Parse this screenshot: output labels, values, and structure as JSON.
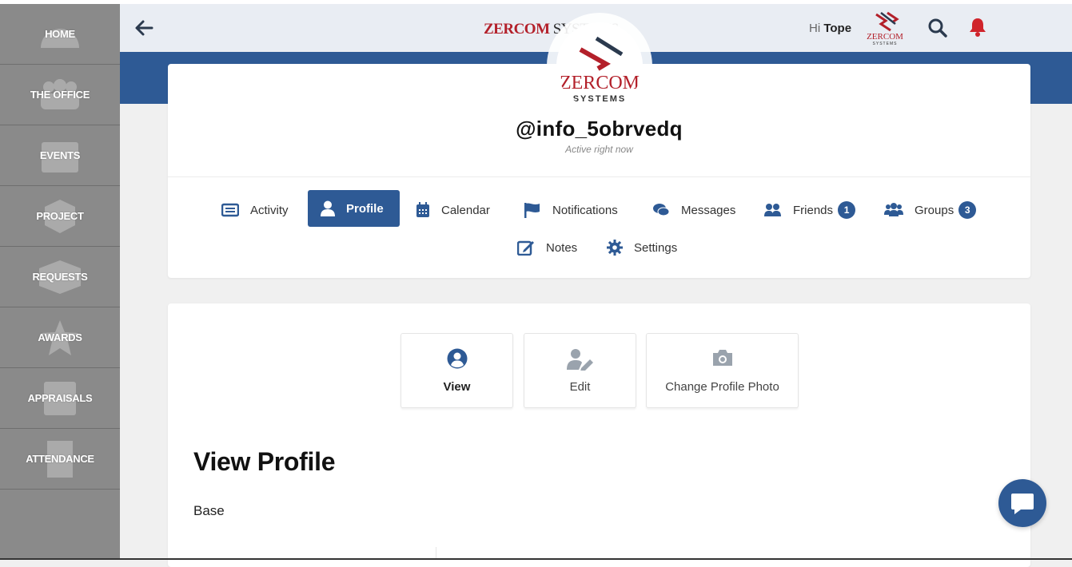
{
  "sidebar": {
    "items": [
      {
        "label": "HOME",
        "icon": "dashboard-icon"
      },
      {
        "label": "THE OFFICE",
        "icon": "people-icon"
      },
      {
        "label": "EVENTS",
        "icon": "calendar-icon"
      },
      {
        "label": "PROJECT",
        "icon": "cubes-icon"
      },
      {
        "label": "REQUESTS",
        "icon": "box-icon"
      },
      {
        "label": "AWARDS",
        "icon": "star-icon"
      },
      {
        "label": "APPRAISALS",
        "icon": "grade-icon"
      },
      {
        "label": "ATTENDANCE",
        "icon": "building-icon"
      }
    ]
  },
  "header": {
    "brand_part1": "ZERCOM",
    "brand_part2": " SYSTEMS",
    "greeting": "Hi",
    "user_name": "Tope",
    "accent_color": "#2e5a95",
    "brand_red": "#b3202a"
  },
  "logo": {
    "text": "ZERCOM",
    "subtext": "SYSTEMS"
  },
  "profile": {
    "username": "@info_5obrvedq",
    "status": "Active right now"
  },
  "tabs": [
    {
      "label": "Activity"
    },
    {
      "label": "Profile"
    },
    {
      "label": "Calendar"
    },
    {
      "label": "Notifications"
    },
    {
      "label": "Messages"
    },
    {
      "label": "Friends",
      "count": "1"
    },
    {
      "label": "Groups",
      "count": "3"
    },
    {
      "label": "Notes"
    },
    {
      "label": "Settings"
    }
  ],
  "actions": [
    {
      "label": "View"
    },
    {
      "label": "Edit"
    },
    {
      "label": "Change Profile Photo"
    }
  ],
  "main": {
    "heading": "View Profile",
    "section": "Base"
  }
}
